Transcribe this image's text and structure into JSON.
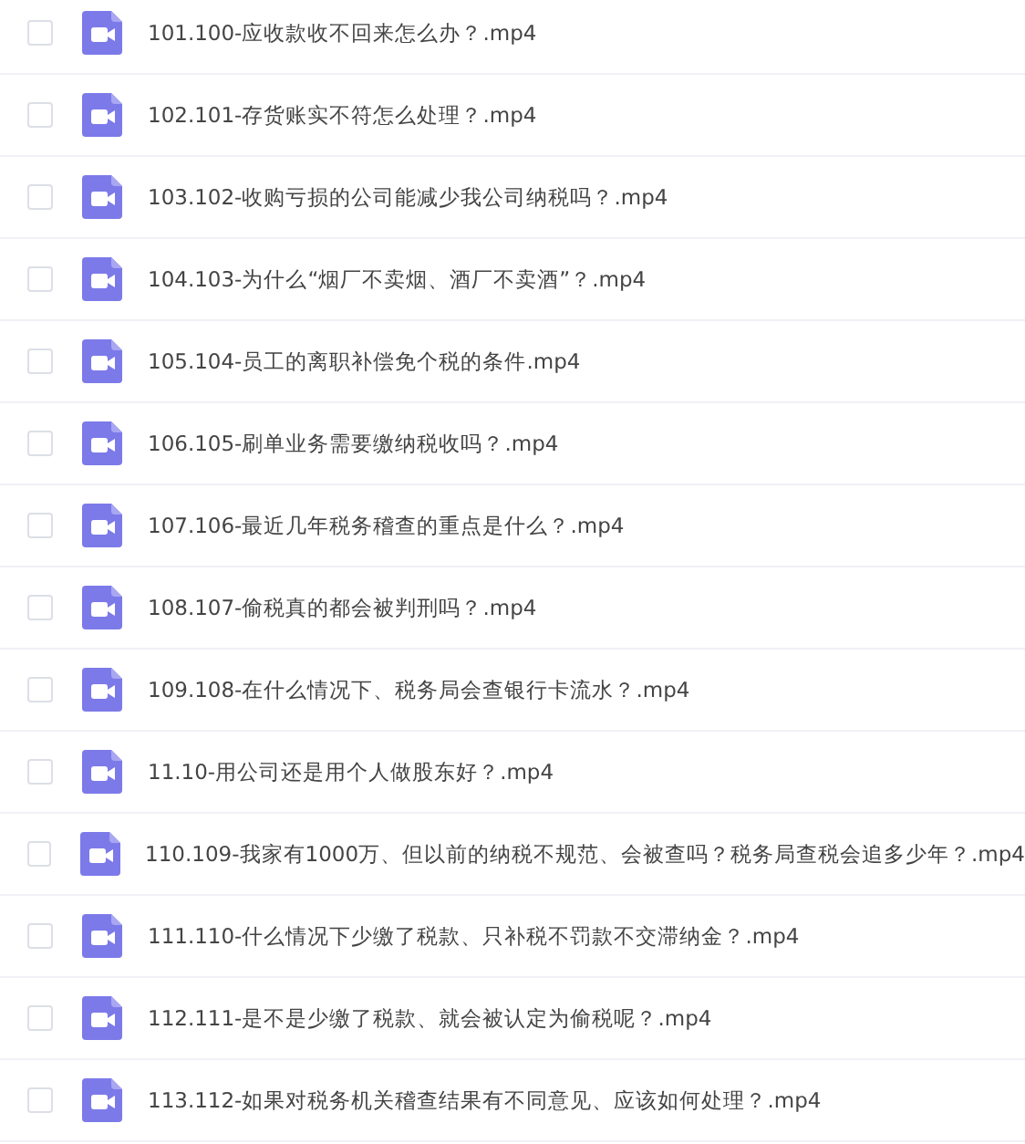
{
  "files": [
    {
      "name": "101.100-应收款收不回来怎么办？.mp4",
      "checked": false
    },
    {
      "name": "102.101-存货账实不符怎么处理？.mp4",
      "checked": false
    },
    {
      "name": "103.102-收购亏损的公司能减少我公司纳税吗？.mp4",
      "checked": false
    },
    {
      "name": "104.103-为什么“烟厂不卖烟、酒厂不卖酒”？.mp4",
      "checked": false
    },
    {
      "name": "105.104-员工的离职补偿免个税的条件.mp4",
      "checked": false
    },
    {
      "name": "106.105-刷单业务需要缴纳税收吗？.mp4",
      "checked": false
    },
    {
      "name": "107.106-最近几年税务稽查的重点是什么？.mp4",
      "checked": false
    },
    {
      "name": "108.107-偷税真的都会被判刑吗？.mp4",
      "checked": false
    },
    {
      "name": "109.108-在什么情况下、税务局会查银行卡流水？.mp4",
      "checked": false
    },
    {
      "name": "11.10-用公司还是用个人做股东好？.mp4",
      "checked": false
    },
    {
      "name": "110.109-我家有1000万、但以前的纳税不规范、会被查吗？税务局查税会追多少年？.mp4",
      "checked": false
    },
    {
      "name": "111.110-什么情况下少缴了税款、只补税不罚款不交滞纳金？.mp4",
      "checked": false
    },
    {
      "name": "112.111-是不是少缴了税款、就会被认定为偷税呢？.mp4",
      "checked": false
    },
    {
      "name": "113.112-如果对税务机关稽查结果有不同意见、应该如何处理？.mp4",
      "checked": false
    }
  ]
}
